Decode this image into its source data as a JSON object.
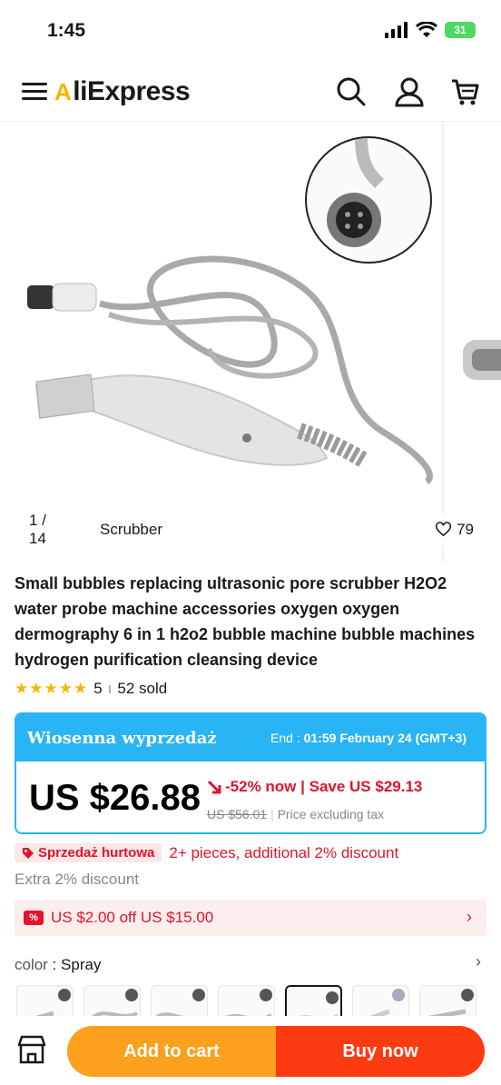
{
  "status": {
    "time": "1:45",
    "battery": "31"
  },
  "header": {
    "logo_accent": "A",
    "logo_text": "liExpress"
  },
  "gallery": {
    "counter": "1 / 14",
    "tag": "Scrubber",
    "likes": "79"
  },
  "product": {
    "title": "Small bubbles replacing ultrasonic pore scrubber H2O2 water probe machine accessories oxygen oxygen dermography 6 in 1 h2o2 bubble machine bubble machines hydrogen purification cleansing device",
    "rating": "5",
    "sold": "52 sold"
  },
  "sale": {
    "name": "Wiosenna wyprzedaż",
    "end_label": "End :",
    "end_value": "01:59 February 24 (GMT+3)",
    "price": "US $26.88",
    "discount": "-52% now | Save US $29.13",
    "original_price": "US $56.01",
    "tax_note": "Price excluding tax"
  },
  "wholesale": {
    "badge": "Sprzedaż hurtowa",
    "text": "2+ pieces, additional 2% discount",
    "extra": "Extra 2% discount"
  },
  "coupon": {
    "icon_text": "%",
    "text": "US $2.00 off US $15.00"
  },
  "variant": {
    "label": "color",
    "value": "Spray",
    "selected_index": 4,
    "count": 7
  },
  "actions": {
    "add_to_cart": "Add to cart",
    "buy_now": "Buy now"
  },
  "colors": {
    "primary_red": "#e0142a",
    "sale_blue": "#28b4f5",
    "cart_orange": "#fca01d",
    "buy_red": "#fd3b12"
  }
}
